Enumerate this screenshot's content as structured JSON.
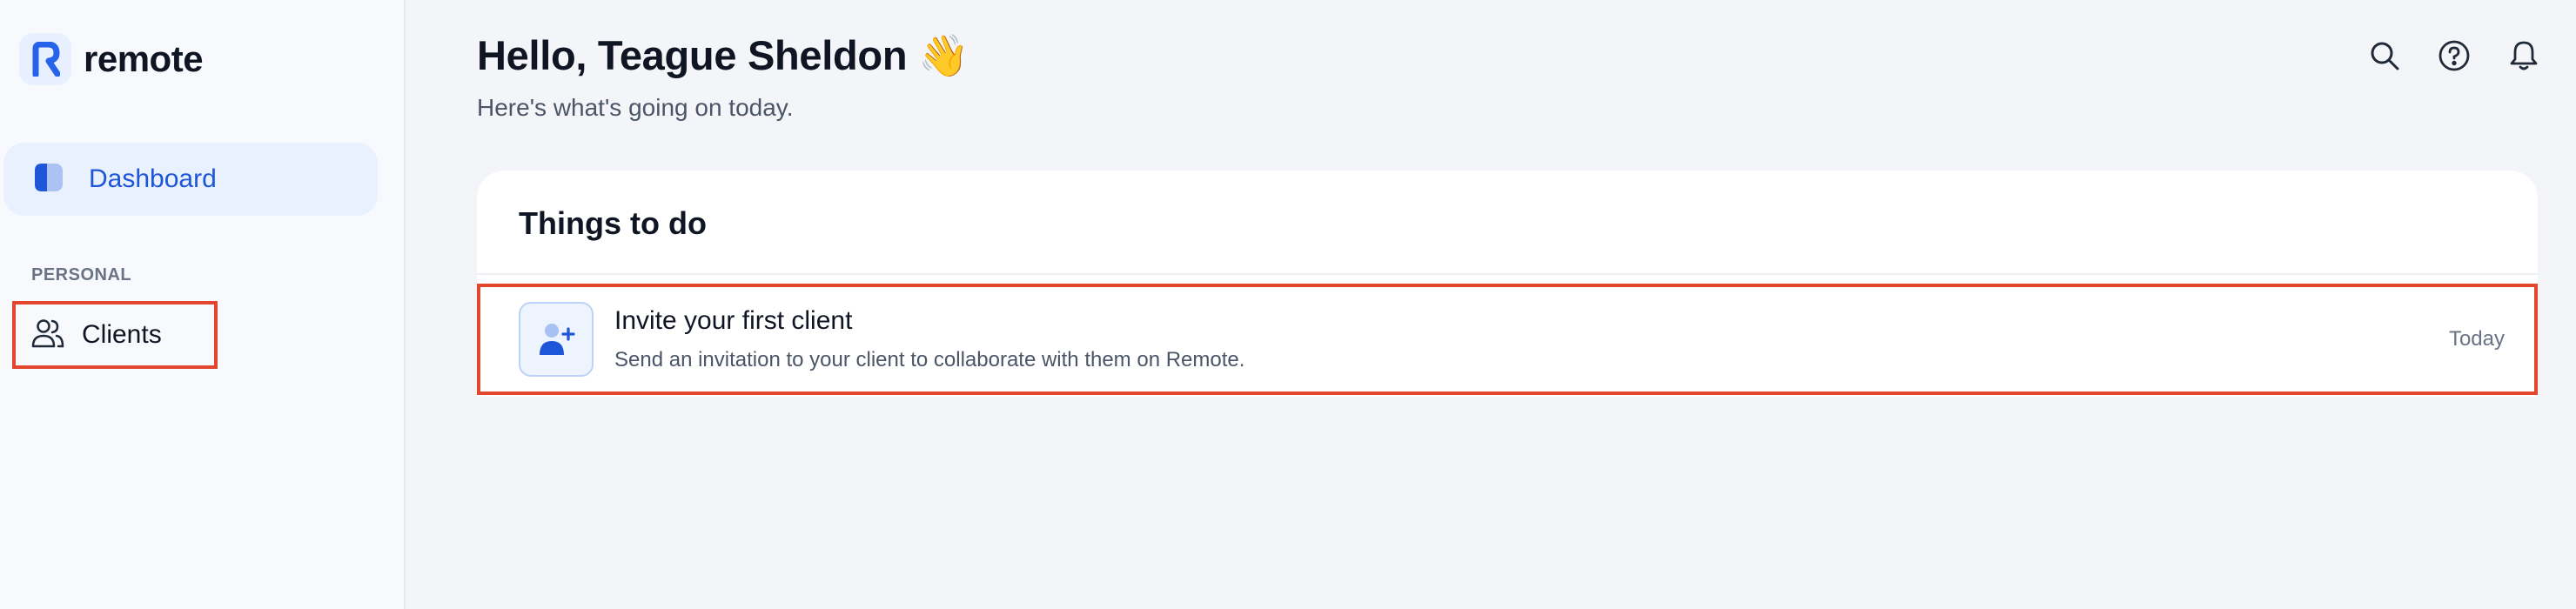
{
  "brand": {
    "name": "remote",
    "logo_icon": "remote-r-logo-icon"
  },
  "sidebar": {
    "dashboard": {
      "label": "Dashboard",
      "icon": "dashboard-icon"
    },
    "section_label": "PERSONAL",
    "clients": {
      "label": "Clients",
      "icon": "users-icon"
    }
  },
  "header": {
    "greeting": "Hello, Teague Sheldon 👋",
    "subtitle": "Here's what's going on today.",
    "icons": [
      "search-icon",
      "help-icon",
      "bell-icon"
    ]
  },
  "things_to_do": {
    "title": "Things to do",
    "tasks": [
      {
        "title": "Invite your first client",
        "description": "Send an invitation to your client to collaborate with them on Remote.",
        "date": "Today",
        "icon": "add-user-icon"
      }
    ]
  },
  "colors": {
    "accent": "#1d56d8",
    "highlight_border": "#e2462c",
    "sidebar_bg": "#f8f9fd",
    "main_bg": "#f4f5f8"
  }
}
